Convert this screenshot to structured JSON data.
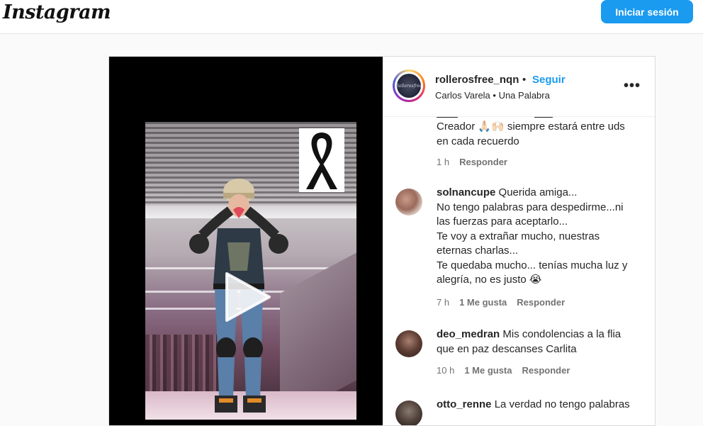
{
  "topbar": {
    "logo": "Instagram",
    "login_button": "Iniciar sesión"
  },
  "post": {
    "header": {
      "username": "rollerosfree_nqn",
      "separator": "•",
      "follow": "Seguir",
      "audio": "Carlos Varela • Una Palabra",
      "avatar_text": "Rollerosfree",
      "more": "•••"
    },
    "comments": [
      {
        "username": "",
        "text_lines": [
          "Creador 🙏🏻🙌🏻 siempre estará entre uds",
          "en cada recuerdo"
        ],
        "time": "1 h",
        "likes": "",
        "reply": "Responder"
      },
      {
        "username": "solnancupe",
        "text_lines": [
          "Querida amiga...",
          "No tengo palabras para despedirme...ni",
          "las fuerzas para aceptarlo...",
          "Te voy a extrañar mucho, nuestras",
          "eternas charlas...",
          "Te quedaba mucho... tenías mucha luz y",
          "alegría, no es justo 😭"
        ],
        "time": "7 h",
        "likes": "1 Me gusta",
        "reply": "Responder"
      },
      {
        "username": "deo_medran",
        "text_lines": [
          "Mis condolencias a la flia",
          "que en paz descanses Carlita"
        ],
        "time": "10 h",
        "likes": "1 Me gusta",
        "reply": "Responder"
      },
      {
        "username": "otto_renne",
        "text_lines": [
          "La verdad no tengo palabras"
        ],
        "time": "",
        "likes": "",
        "reply": ""
      }
    ]
  },
  "icons": {
    "play": "play-icon",
    "ribbon": "mourning-ribbon-icon",
    "more": "more-options-icon"
  },
  "colors": {
    "accent": "#1a9bf0",
    "text": "#262626",
    "muted": "#737373"
  }
}
